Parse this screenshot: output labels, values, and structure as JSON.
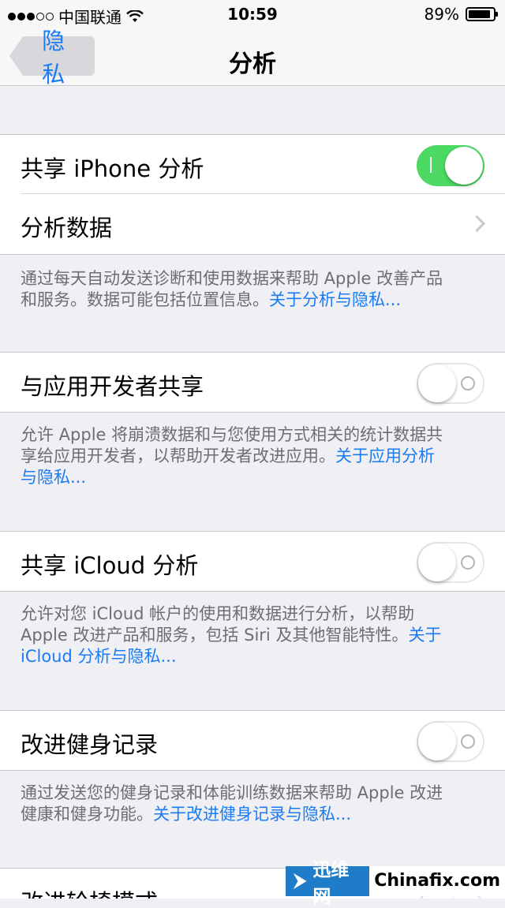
{
  "status_bar": {
    "carrier": "中国联通",
    "time": "10:59",
    "battery": "89%"
  },
  "nav": {
    "back_label": "隐私",
    "title": "分析"
  },
  "cells": {
    "share_iphone": {
      "label": "共享 iPhone 分析",
      "toggle": "on"
    },
    "analytics_data": {
      "label": "分析数据"
    },
    "share_dev": {
      "label": "与应用开发者共享",
      "toggle": "off"
    },
    "share_icloud": {
      "label": "共享 iCloud 分析",
      "toggle": "off"
    },
    "improve_fitness": {
      "label": "改进健身记录",
      "toggle": "off"
    },
    "improve_wheelchair": {
      "label": "改进轮椅模式"
    }
  },
  "footers": {
    "f1_line1": "通过每天自动发送诊断和使用数据来帮助 Apple 改善产品",
    "f1_line2": "和服务。数据可能包括位置信息。",
    "f1_link": "关于分析与隐私...",
    "f2_line1": "允许 Apple 将崩溃数据和与您使用方式相关的统计数据共",
    "f2_line2": "享给应用开发者，以帮助开发者改进应用。",
    "f2_link_a": "关于应用分析",
    "f2_link_b": "与隐私...",
    "f3_line1": "允许对您 iCloud 帐户的使用和数据进行分析，以帮助",
    "f3_line2": "Apple 改进产品和服务，包括 Siri 及其他智能特性。",
    "f3_link_a": "关于",
    "f3_link_b": "iCloud 分析与隐私...",
    "f4_line1": "通过发送您的健身记录和体能训练数据来帮助 Apple 改进",
    "f4_line2": "健康和健身功能。",
    "f4_link": "关于改进健身记录与隐私..."
  },
  "watermark": {
    "brand_cn": "迅维网",
    "brand_en": "Chinafix.com"
  },
  "colors": {
    "accent": "#1a7cf4",
    "toggle_on": "#4cd964",
    "background": "#efeff4"
  }
}
